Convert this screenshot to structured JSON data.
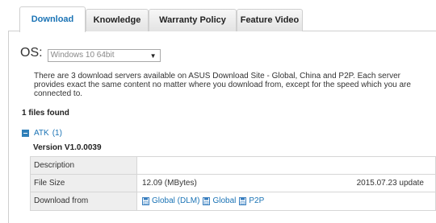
{
  "tabs": [
    {
      "label": "Download",
      "active": true
    },
    {
      "label": "Knowledge",
      "active": false
    },
    {
      "label": "Warranty Policy",
      "active": false
    },
    {
      "label": "Feature Video",
      "active": false
    }
  ],
  "os": {
    "label": "OS:",
    "selected": "Windows 10 64bit"
  },
  "notice": "There are 3 download servers available on ASUS Download Site - Global, China and P2P. Each server provides exact the same content no matter where you download from, except for the speed which you are connected to.",
  "files_found": "1 files found",
  "group": {
    "name": "ATK",
    "count": "(1)",
    "version": "Version  V1.0.0039"
  },
  "details": {
    "description_label": "Description",
    "description_value": "",
    "filesize_label": "File Size",
    "filesize_value": "12.09 (MBytes)",
    "update_value": "2015.07.23  update",
    "download_label": "Download from",
    "links": [
      "Global (DLM)",
      "Global",
      "P2P"
    ]
  },
  "colors": {
    "link": "#1a73b5",
    "accent_icon": "#2f7fb8"
  },
  "icons": {
    "download_icon": "floppy-disk-icon",
    "collapse_icon": "minus-square-icon",
    "dropdown_icon": "caret-down-icon"
  }
}
